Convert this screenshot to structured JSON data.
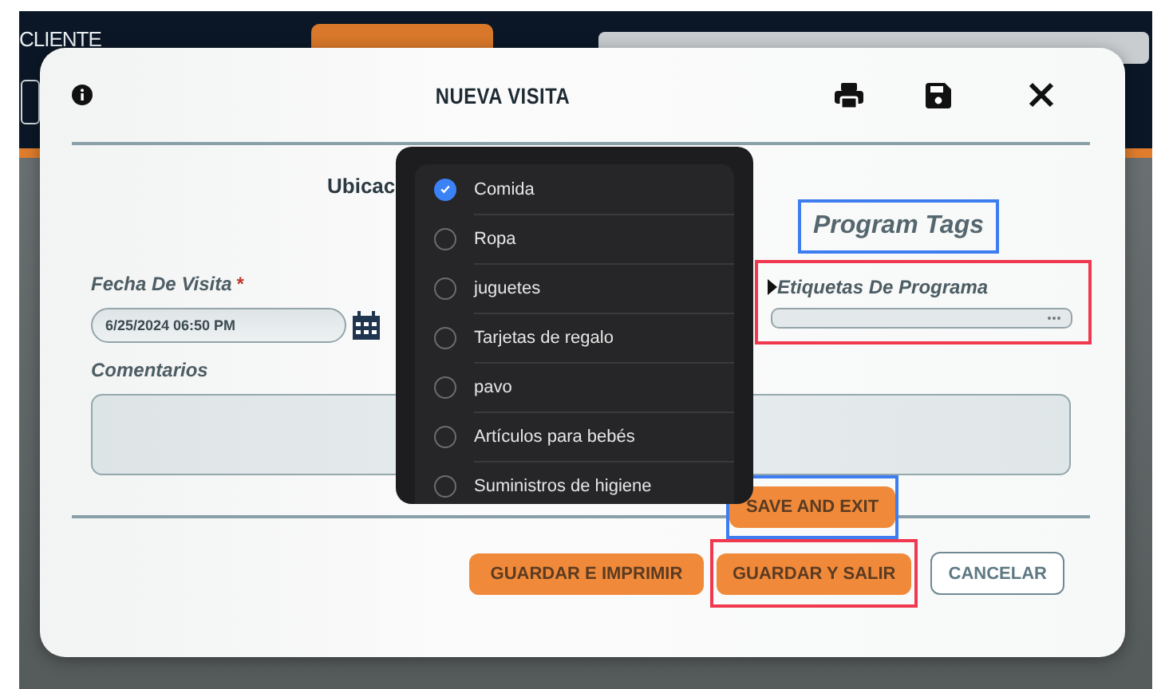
{
  "background": {
    "header_title": "CLIENTE"
  },
  "modal": {
    "title": "NUEVA VISITA",
    "location_label": "Ubicac",
    "visit_date": {
      "label": "Fecha De Visita",
      "required_mark": "*",
      "value": "6/25/2024 06:50 PM"
    },
    "program_tags": {
      "heading": "Program Tags",
      "heading_frame": {
        "color": "#3d7df0"
      },
      "label": "Etiquetas De Programa",
      "color": "#f0384e"
    },
    "comments": {
      "label": "Comentarios"
    },
    "save_and_exit": {
      "label": "SAVE AND EXIT",
      "color": "#3d7df0"
    },
    "buttons": [
      {
        "label": "GUARDAR E IMPRIMIR",
        "kind": "primary"
      },
      {
        "label": "GUARDAR Y SALIR",
        "kind": "primary",
        "color": "#f0384e"
      },
      {
        "label": "CANCELAR",
        "kind": "secondary"
      }
    ]
  },
  "tag_options": [
    {
      "label": "Comida",
      "selected": true
    },
    {
      "label": "Ropa",
      "selected": false
    },
    {
      "label": "juguetes",
      "selected": false
    },
    {
      "label": "Tarjetas de regalo",
      "selected": false
    },
    {
      "label": "pavo",
      "selected": false
    },
    {
      "label": "Artículos para bebés",
      "selected": false
    },
    {
      "label": "Suministros de higiene",
      "selected": false
    }
  ]
}
